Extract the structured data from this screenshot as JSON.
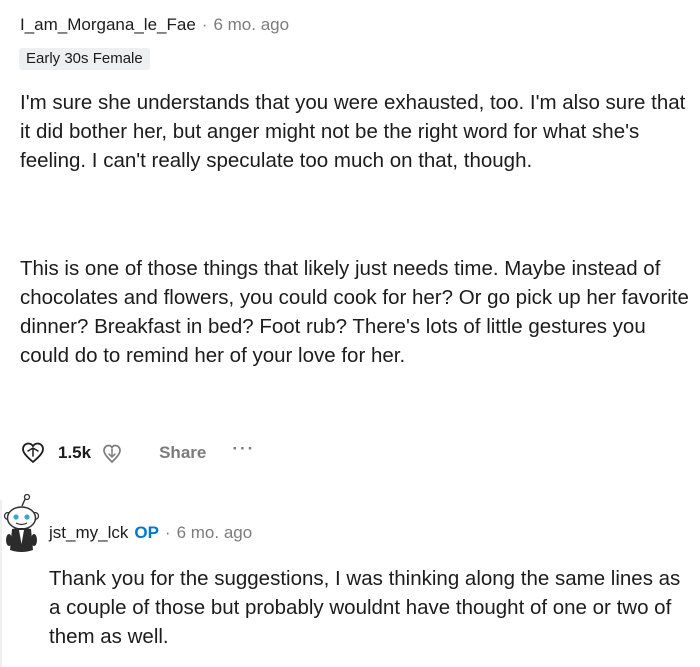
{
  "comment": {
    "username": "I_am_Morgana_le_Fae",
    "separator": "·",
    "time_ago": "6 mo. ago",
    "flair": "Early 30s Female",
    "paragraphs": [
      "I'm sure she understands that you were exhausted, too. I'm also sure that it did bother her, but anger might not be the right word for what she's feeling. I can't really speculate too much on that, though.",
      "This is one of those things that likely just needs time. Maybe instead of chocolates and flowers, you could cook for her? Or go pick up her favorite dinner? Breakfast in bed? Foot rub? There's lots of little gestures you could do to remind her of your love for her."
    ],
    "actions": {
      "upvote_icon": "upvote-icon",
      "vote_count": "1.5k",
      "downvote_icon": "downvote-icon",
      "share_label": "Share",
      "more_label": "···"
    }
  },
  "reply": {
    "avatar_icon": "snoo-avatar",
    "username": "jst_my_lck",
    "op_badge": "OP",
    "separator": "·",
    "time_ago": "6 mo. ago",
    "text": "Thank you for the suggestions, I was thinking along the same lines as a couple of those but probably wouldnt have thought of one or two of them as well."
  },
  "colors": {
    "text": "#1c1c1c",
    "meta": "#7c7c7c",
    "op_blue": "#0079d3",
    "flair_bg": "#edeff1"
  }
}
